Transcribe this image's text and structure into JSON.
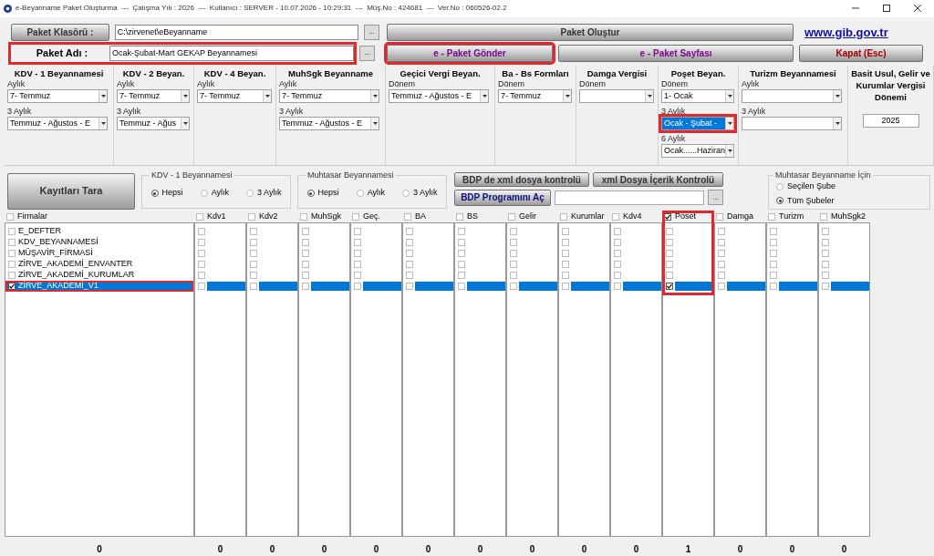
{
  "window": {
    "title": "e-Beyanname Paket Oluşturma  ---  Çalışma Yılı : 2026  ---  Kullanıcı : SERVER - 10.07.2026 - 10:29:31  ---  Müş.No : 424681  ---  Ver.No : 060526-02.2"
  },
  "folder": {
    "label": "Paket Klasörü :",
    "value": "C:\\zirvenet\\eBeyanname",
    "browse": "..."
  },
  "package_name": {
    "label": "Paket Adı :",
    "value": "Ocak-Şubat-Mart GEKAP Beyannamesi",
    "browse": "...",
    "highlighted": true
  },
  "link": "www.gib.gov.tr",
  "buttons": [
    {
      "label": "Paket Oluştur",
      "kind": "wide",
      "highlighted": false
    },
    {
      "label": "e - Paket Gönder",
      "kind": "send",
      "highlighted": true
    },
    {
      "label": "e - Paket Sayfası",
      "kind": "page",
      "highlighted": false
    },
    {
      "label": "Kapat (Esc)",
      "kind": "close",
      "highlighted": false
    }
  ],
  "groups": [
    {
      "title": "KDV - 1 Beyannamesi",
      "fields": [
        {
          "label": "Aylık",
          "value": "7- Temmuz",
          "kind": "combo",
          "highlighted": false
        },
        {
          "label": "3 Aylık",
          "value": "Temmuz - Ağustos - E",
          "kind": "combo",
          "highlighted": false
        }
      ]
    },
    {
      "title": "KDV - 2 Beyan.",
      "fields": [
        {
          "label": "Aylık",
          "value": "7- Temmuz",
          "kind": "combo",
          "highlighted": false
        },
        {
          "label": "3 Aylık",
          "value": "Temmuz - Ağus",
          "kind": "combo",
          "highlighted": false
        }
      ]
    },
    {
      "title": "KDV - 4 Beyan.",
      "fields": [
        {
          "label": "Aylık",
          "value": "7- Temmuz",
          "kind": "combo",
          "highlighted": false
        }
      ]
    },
    {
      "title": "MuhSgk Beyanname",
      "fields": [
        {
          "label": "Aylık",
          "value": "7- Temmuz",
          "kind": "combo",
          "highlighted": false
        },
        {
          "label": "3 Aylık",
          "value": "Temmuz - Ağustos - E",
          "kind": "combo",
          "highlighted": false
        }
      ]
    },
    {
      "title": "Geçici Vergi Beyan.",
      "fields": [
        {
          "label": "Dönem",
          "value": "Temmuz - Ağustos - E",
          "kind": "combo",
          "highlighted": false
        }
      ]
    },
    {
      "title": "Ba - Bs Formları",
      "fields": [
        {
          "label": "Dönem",
          "value": "7- Temmuz",
          "kind": "combo",
          "highlighted": false
        }
      ]
    },
    {
      "title": "Damga Vergisi",
      "fields": [
        {
          "label": "Dönem",
          "kind": "combo",
          "highlighted": false
        }
      ]
    },
    {
      "title": "Poşet Beyan.",
      "fields": [
        {
          "label": "Dönem",
          "value": "1- Ocak",
          "kind": "combo",
          "highlighted": false
        },
        {
          "label": "3 Aylık",
          "value": "Ocak - Şubat -",
          "kind": "combo",
          "highlighted": true
        },
        {
          "label": "6 Aylık",
          "value": "Ocak......Haziran",
          "kind": "combo",
          "highlighted": false
        }
      ]
    },
    {
      "title": "Turizm Beyannamesi",
      "fields": [
        {
          "label": "Aylık",
          "kind": "combo",
          "highlighted": false
        },
        {
          "label": "3 Aylık",
          "kind": "combo",
          "highlighted": false
        }
      ]
    },
    {
      "title": "Basit Usul, Gelir ve Kurumlar Vergisi Dönemi",
      "fields": [
        {
          "value": "2025",
          "kind": "text",
          "highlighted": false
        }
      ]
    }
  ],
  "scan_button": "Kayıtları Tara",
  "radio_groups": [
    {
      "title": "KDV - 1 Beyannamesi",
      "options": [
        {
          "label": "Hepsi",
          "selected": true
        },
        {
          "label": "Aylık",
          "selected": false
        },
        {
          "label": "3 Aylık",
          "selected": false
        }
      ]
    },
    {
      "title": "Muhtasar Beyannamesi",
      "options": [
        {
          "label": "Hepsi",
          "selected": true
        },
        {
          "label": "Aylık",
          "selected": false
        },
        {
          "label": "3 Aylık",
          "selected": false
        }
      ]
    }
  ],
  "tool_buttons": [
    {
      "label": "BDP de xml dosya kontrolü"
    },
    {
      "label": "xml Dosya İçerik Kontrolü"
    }
  ],
  "bdp_button": "BDP Programını Aç",
  "bdp_browse": "...",
  "branch_group": {
    "title": "Muhtasar Beyanname İçin",
    "options": [
      {
        "label": "Seçilen Şube",
        "selected": false
      },
      {
        "label": "Tüm Şubeler",
        "selected": true
      }
    ]
  },
  "firms": {
    "header": "Firmalar",
    "checked": false,
    "total": "0",
    "items": [
      {
        "name": "E_DEFTER",
        "checked": false,
        "selected": false,
        "highlighted": false
      },
      {
        "name": "KDV_BEYANNAMESİ",
        "checked": false,
        "selected": false,
        "highlighted": false
      },
      {
        "name": "MÜŞAVİR_FİRMASİ",
        "checked": false,
        "selected": false,
        "highlighted": false
      },
      {
        "name": "ZİRVE_AKADEMİ_ENVANTER",
        "checked": false,
        "selected": false,
        "highlighted": false
      },
      {
        "name": "ZİRVE_AKADEMİ_KURUMLAR",
        "checked": false,
        "selected": false,
        "highlighted": false
      },
      {
        "name": "ZİRVE_AKADEMİ_V1",
        "checked": true,
        "selected": true,
        "highlighted": true
      }
    ]
  },
  "columns": [
    {
      "label": "Kdv1",
      "checked": false,
      "highlighted": false,
      "total": "0",
      "cells": [
        false,
        false,
        false,
        false,
        false,
        false
      ]
    },
    {
      "label": "Kdv2",
      "checked": false,
      "highlighted": false,
      "total": "0",
      "cells": [
        false,
        false,
        false,
        false,
        false,
        false
      ]
    },
    {
      "label": "MuhSgk",
      "checked": false,
      "highlighted": false,
      "total": "0",
      "cells": [
        false,
        false,
        false,
        false,
        false,
        false
      ]
    },
    {
      "label": "Geç.",
      "checked": false,
      "highlighted": false,
      "total": "0",
      "cells": [
        false,
        false,
        false,
        false,
        false,
        false
      ]
    },
    {
      "label": "BA",
      "checked": false,
      "highlighted": false,
      "total": "0",
      "cells": [
        false,
        false,
        false,
        false,
        false,
        false
      ]
    },
    {
      "label": "BS",
      "checked": false,
      "highlighted": false,
      "total": "0",
      "cells": [
        false,
        false,
        false,
        false,
        false,
        false
      ]
    },
    {
      "label": "Gelir",
      "checked": false,
      "highlighted": false,
      "total": "0",
      "cells": [
        false,
        false,
        false,
        false,
        false,
        false
      ]
    },
    {
      "label": "Kurumlar",
      "checked": false,
      "highlighted": false,
      "total": "0",
      "cells": [
        false,
        false,
        false,
        false,
        false,
        false
      ]
    },
    {
      "label": "Kdv4",
      "checked": false,
      "highlighted": false,
      "total": "0",
      "cells": [
        false,
        false,
        false,
        false,
        false,
        false
      ]
    },
    {
      "label": "Poset",
      "checked": true,
      "highlighted": true,
      "total": "1",
      "cells": [
        false,
        false,
        false,
        false,
        false,
        true
      ]
    },
    {
      "label": "Damga",
      "checked": false,
      "highlighted": false,
      "total": "0",
      "cells": [
        false,
        false,
        false,
        false,
        false,
        false
      ]
    },
    {
      "label": "Turizm",
      "checked": false,
      "highlighted": false,
      "total": "0",
      "cells": [
        false,
        false,
        false,
        false,
        false,
        false
      ]
    },
    {
      "label": "MuhSgk2",
      "checked": false,
      "highlighted": false,
      "total": "0",
      "cells": [
        false,
        false,
        false,
        false,
        false,
        false
      ]
    }
  ]
}
